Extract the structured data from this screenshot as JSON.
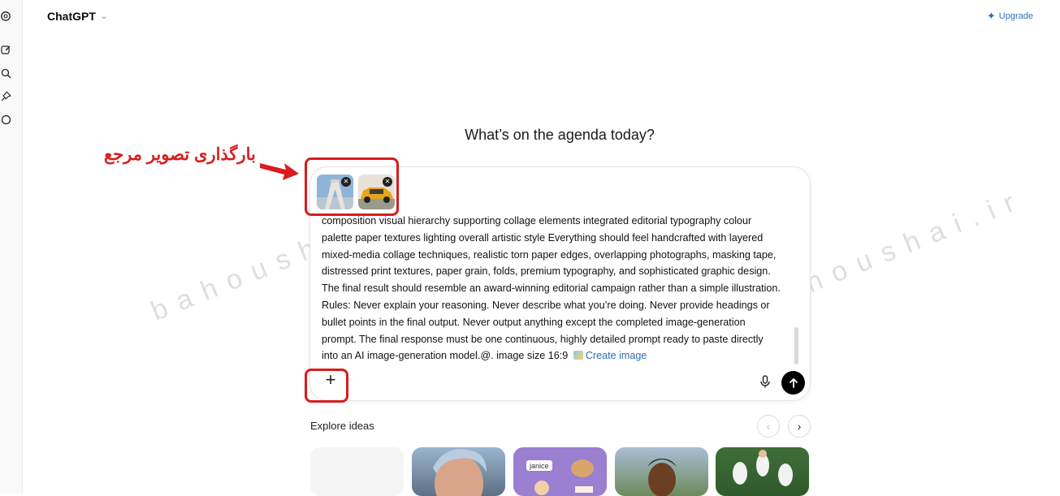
{
  "app": {
    "name": "ChatGPT"
  },
  "header": {
    "upgrade_label": "Upgrade"
  },
  "hero": {
    "title": "What’s on the agenda today?"
  },
  "composer": {
    "prompt_lines": [
      "composition visual hierarchy supporting collage elements integrated editorial typography colour",
      "palette paper textures lighting overall artistic style Everything should feel handcrafted with layered",
      "mixed-media collage techniques, realistic torn paper edges, overlapping photographs, masking tape,",
      "distressed print textures, paper grain, folds, premium typography, and sophisticated graphic design.",
      "The final result should resemble an award-winning editorial campaign rather than a simple illustration.",
      "Rules: Never explain your reasoning. Never describe what you’re doing. Never provide headings or",
      "bullet points in the final output. Never output anything except the completed image-generation",
      "prompt. The final response must be one continuous, highly detailed prompt ready to paste directly"
    ],
    "prompt_last_line": "into an AI image-generation model.@. image size 16:9",
    "create_image_label": "Create image",
    "attachments": [
      "building-photo",
      "yellow-car-photo"
    ],
    "plus_label": "+"
  },
  "explore": {
    "title": "Explore ideas"
  },
  "annotation": {
    "text": "بارگذاری تصویر مرجع"
  },
  "watermark": {
    "text": "bahoushai.ir"
  },
  "colors": {
    "accent": "#2f6fb5",
    "annotation": "#d91c1c"
  }
}
